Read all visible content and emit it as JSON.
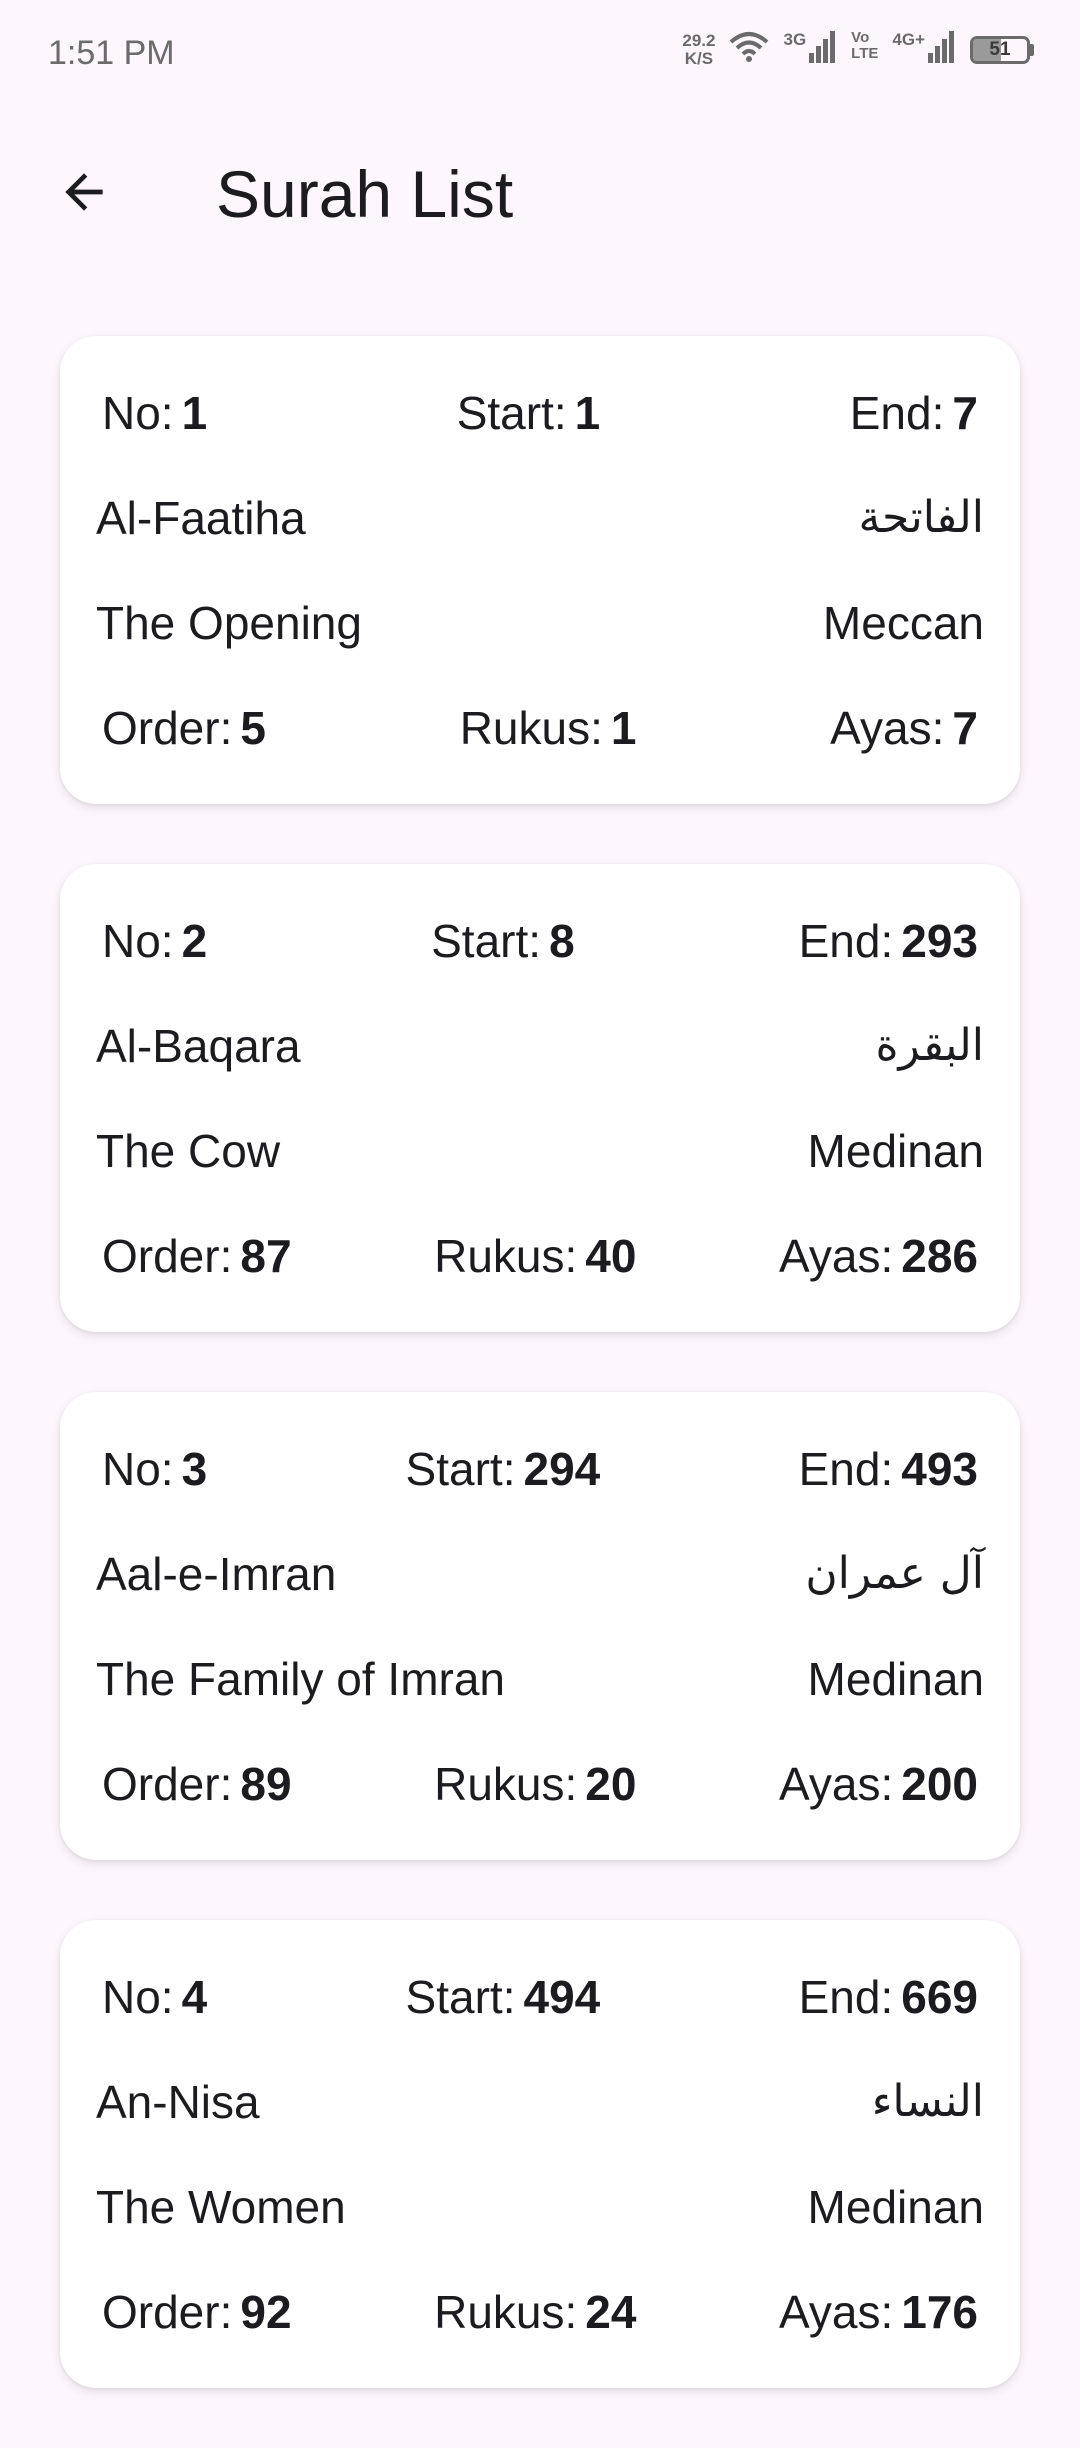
{
  "status_bar": {
    "time": "1:51 PM",
    "net_speed_value": "29.2",
    "net_speed_unit": "K/S",
    "network_3g": "3G",
    "volte_top": "Vo",
    "volte_bottom": "LTE",
    "network_4g": "4G+",
    "battery_level": "51",
    "battery_fraction": 0.51
  },
  "header": {
    "title": "Surah List",
    "back_icon": "arrow-back-icon"
  },
  "labels": {
    "no": "No:",
    "start": "Start:",
    "end": "End:",
    "order": "Order:",
    "rukus": "Rukus:",
    "ayas": "Ayas:"
  },
  "surahs": [
    {
      "no": "1",
      "start": "1",
      "end": "7",
      "name_en": "Al-Faatiha",
      "name_ar": "الفاتحة",
      "meaning": "The Opening",
      "type": "Meccan",
      "order": "5",
      "rukus": "1",
      "ayas": "7"
    },
    {
      "no": "2",
      "start": "8",
      "end": "293",
      "name_en": "Al-Baqara",
      "name_ar": "البقرة",
      "meaning": "The Cow",
      "type": "Medinan",
      "order": "87",
      "rukus": "40",
      "ayas": "286"
    },
    {
      "no": "3",
      "start": "294",
      "end": "493",
      "name_en": "Aal-e-Imran",
      "name_ar": "آل عمران",
      "meaning": "The Family of Imran",
      "type": "Medinan",
      "order": "89",
      "rukus": "20",
      "ayas": "200"
    },
    {
      "no": "4",
      "start": "494",
      "end": "669",
      "name_en": "An-Nisa",
      "name_ar": "النساء",
      "meaning": "The Women",
      "type": "Medinan",
      "order": "92",
      "rukus": "24",
      "ayas": "176"
    }
  ]
}
